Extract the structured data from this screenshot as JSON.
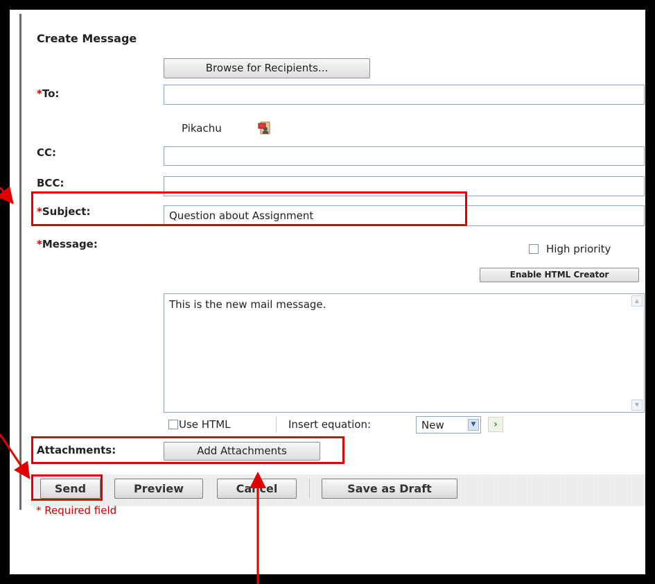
{
  "form": {
    "title": "Create Message",
    "browse_label": "Browse for Recipients...",
    "required_mark": "*",
    "to_label": "To:",
    "to_value": "",
    "recipient_name": "Pikachu",
    "recipient_icon": "address-book-icon",
    "cc_label": "CC:",
    "cc_value": "",
    "bcc_label": "BCC:",
    "bcc_value": "",
    "subject_label": "Subject:",
    "subject_value": "Question about Assignment",
    "message_label": "Message:",
    "high_priority_label": "High priority",
    "enable_html_creator_label": "Enable HTML Creator",
    "message_body": "This is the new mail message.",
    "use_html_label": "Use HTML",
    "insert_equation_label": "Insert equation:",
    "insert_equation_value": "New",
    "attachments_label": "Attachments:",
    "add_attachments_label": "Add Attachments"
  },
  "actions": {
    "send": "Send",
    "preview": "Preview",
    "cancel": "Cancel",
    "save_draft": "Save as Draft"
  },
  "required_note": "* Required field",
  "colors": {
    "required": "#d00000",
    "annotation": "#e00000",
    "field_border": "#8ea6c2"
  }
}
